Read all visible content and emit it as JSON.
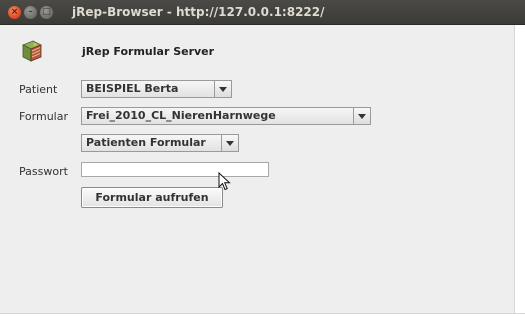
{
  "window": {
    "title": "jRep-Browser - http://127.0.0.1:8222/",
    "close_glyph": "×",
    "minimize_glyph": "–",
    "maximize_glyph": "□"
  },
  "header": {
    "app_icon": "book-icon",
    "title": "jRep Formular Server"
  },
  "form": {
    "patient_label": "Patient",
    "patient_value": "BEISPIEL Berta",
    "formular_label": "Formular",
    "formular_value": "Frei_2010_CL_NierenHarnwege",
    "formular_type_value": "Patienten Formular",
    "password_label": "Passwort",
    "password_value": "",
    "submit_label": "Formular aufrufen"
  },
  "colors": {
    "titlebar": "#3b3a37",
    "close_button": "#dd4a22",
    "window_bg": "#eeeeee"
  }
}
